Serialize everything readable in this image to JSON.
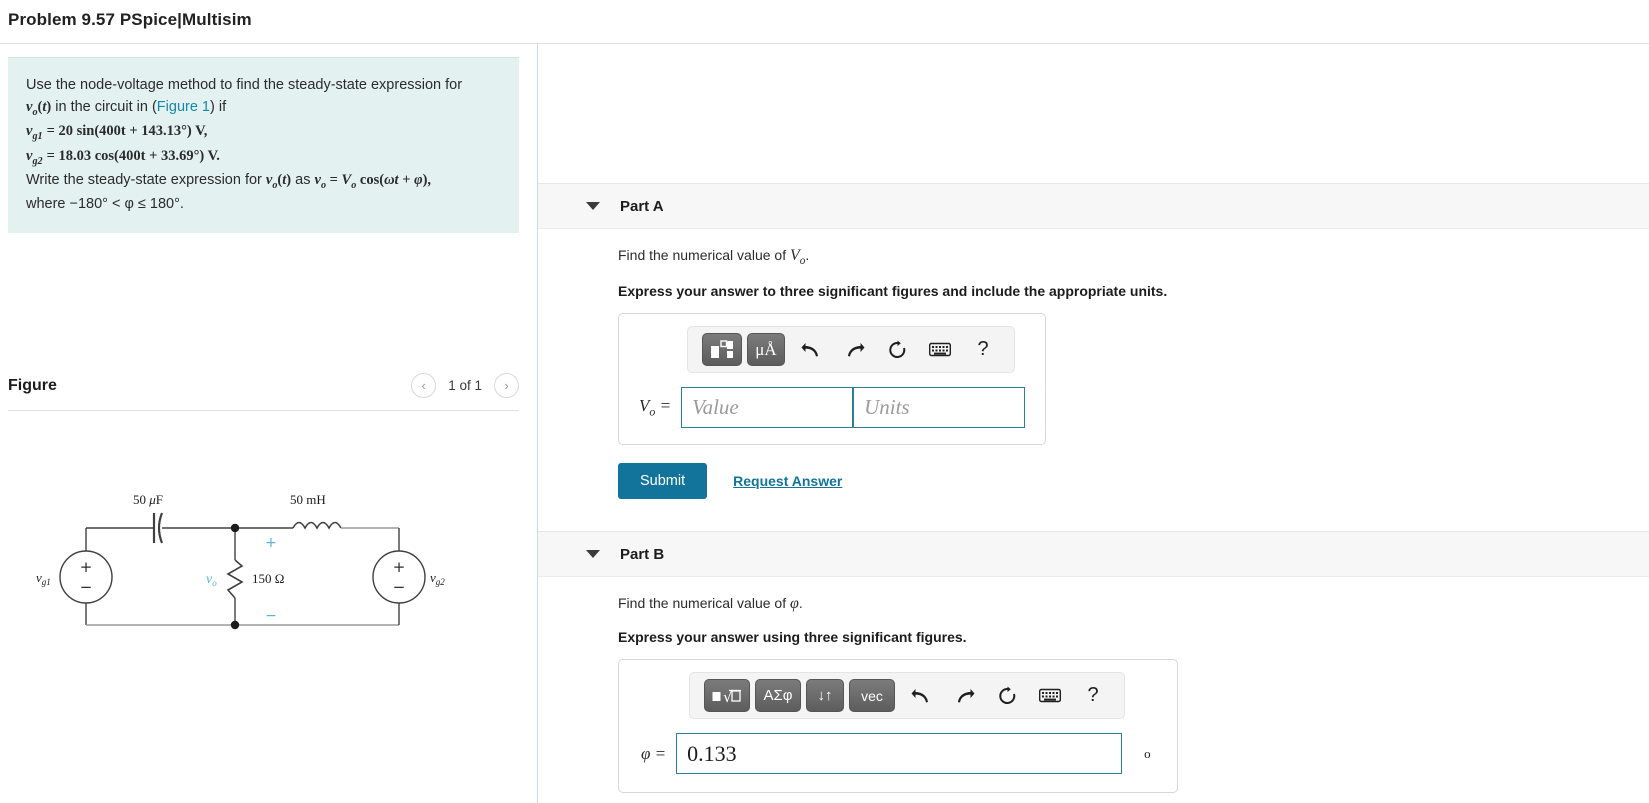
{
  "header": {
    "title": "Problem 9.57 PSpice|Multisim"
  },
  "problem": {
    "line1": "Use the node-voltage method to find the steady-state expression for",
    "line2_pre": "in the circuit in (",
    "line2_link": "Figure 1",
    "line2_post": ") if",
    "vg1": "= 20 sin(400t + 143.13°) V,",
    "vg2": "= 18.03 cos(400t + 33.69°) V.",
    "line5": "Write the steady-state expression for",
    "line5b": "as",
    "line6": "where −180° < φ ≤ 180°.",
    "vo_t": "v",
    "symbol_vo": "vo(t)",
    "symbol_vg1": "vg1",
    "symbol_vg2": "vg2"
  },
  "figure": {
    "title": "Figure",
    "prev_icon": "chevron-left",
    "next_icon": "chevron-right",
    "counter": "1 of 1",
    "circuit": {
      "capacitor_label": "50 μF",
      "inductor_label": "50 mH",
      "resistor_label": "150 Ω",
      "source_left_label": "vg1",
      "source_right_label": "vg2",
      "node_voltage_label": "vo",
      "plus_sign": "+",
      "minus_sign": "−"
    }
  },
  "parts": [
    {
      "id": "part-a",
      "label": "Part A",
      "prompt": "Find the numerical value of Vo.",
      "prompt_plain": "Find the numerical value of ",
      "prompt_symbol": "Vo",
      "instruction": "Express your answer to three significant figures and include the appropriate units.",
      "toolbar": {
        "keys": [
          {
            "name": "template-icon",
            "glyph": "▣"
          },
          {
            "name": "units-icon",
            "glyph": "μÅ"
          }
        ],
        "icons": [
          {
            "name": "undo-icon",
            "glyph": "↰"
          },
          {
            "name": "redo-icon",
            "glyph": "↱"
          },
          {
            "name": "reset-icon",
            "glyph": "↻"
          },
          {
            "name": "keyboard-icon",
            "glyph": "⌨"
          },
          {
            "name": "help-icon",
            "glyph": "?"
          }
        ]
      },
      "var_label": "Vo =",
      "value_placeholder": "Value",
      "units_placeholder": "Units",
      "value": "",
      "units": "",
      "submit_label": "Submit",
      "request_label": "Request Answer"
    },
    {
      "id": "part-b",
      "label": "Part B",
      "prompt_plain": "Find the numerical value of ",
      "prompt_symbol": "φ",
      "prompt_tail": ".",
      "instruction": "Express your answer using three significant figures.",
      "toolbar": {
        "keys": [
          {
            "name": "radical-template-icon",
            "glyph": "√"
          },
          {
            "name": "greek-symbols-icon",
            "glyph": "ΑΣφ"
          },
          {
            "name": "arrows-icon",
            "glyph": "↓↑"
          },
          {
            "name": "vector-icon",
            "glyph": "vec"
          }
        ],
        "icons": [
          {
            "name": "undo-icon",
            "glyph": "↰"
          },
          {
            "name": "redo-icon",
            "glyph": "↱"
          },
          {
            "name": "reset-icon",
            "glyph": "↻"
          },
          {
            "name": "keyboard-icon",
            "glyph": "⌨"
          },
          {
            "name": "help-icon",
            "glyph": "?"
          }
        ]
      },
      "var_label": "φ =",
      "value": "0.133",
      "unit_suffix": "o"
    }
  ],
  "colors": {
    "accent": "#12749a",
    "problem_bg": "#e3f1f0",
    "part_header_bg": "#f7f7f7",
    "input_border": "#2b7f9e",
    "circuit_accent": "#56b4d8"
  }
}
